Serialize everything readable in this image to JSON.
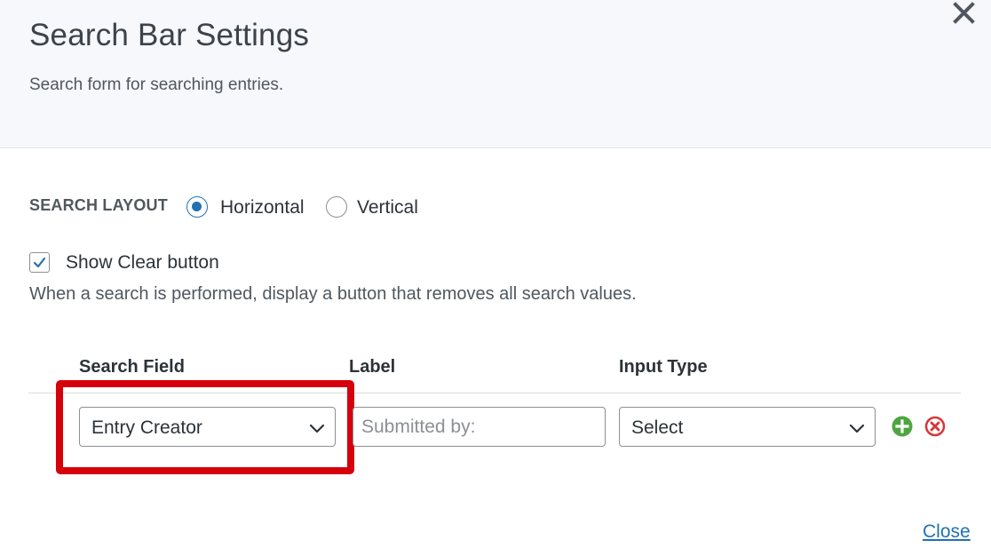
{
  "dialog": {
    "title": "Search Bar Settings",
    "subtitle": "Search form for searching entries."
  },
  "layout": {
    "label": "SEARCH LAYOUT",
    "options": [
      "Horizontal",
      "Vertical"
    ],
    "selected": "Horizontal"
  },
  "clear_button": {
    "label": "Show Clear button",
    "checked": true,
    "helper": "When a search is performed, display a button that removes all search values."
  },
  "table": {
    "headers": [
      "Search Field",
      "Label",
      "Input Type"
    ],
    "rows": [
      {
        "search_field": "Entry Creator",
        "label_placeholder": "Submitted by:",
        "label_value": "",
        "input_type": "Select"
      }
    ]
  },
  "footer": {
    "close_label": "Close"
  },
  "icons": {
    "close": "close-icon",
    "chevron": "chevron-down-icon",
    "add": "plus-circle-icon",
    "remove": "remove-circle-icon",
    "check": "checkmark-icon"
  },
  "colors": {
    "accent": "#2271b1",
    "add": "#4ca640",
    "remove": "#d63638",
    "highlight": "#d6000c"
  }
}
